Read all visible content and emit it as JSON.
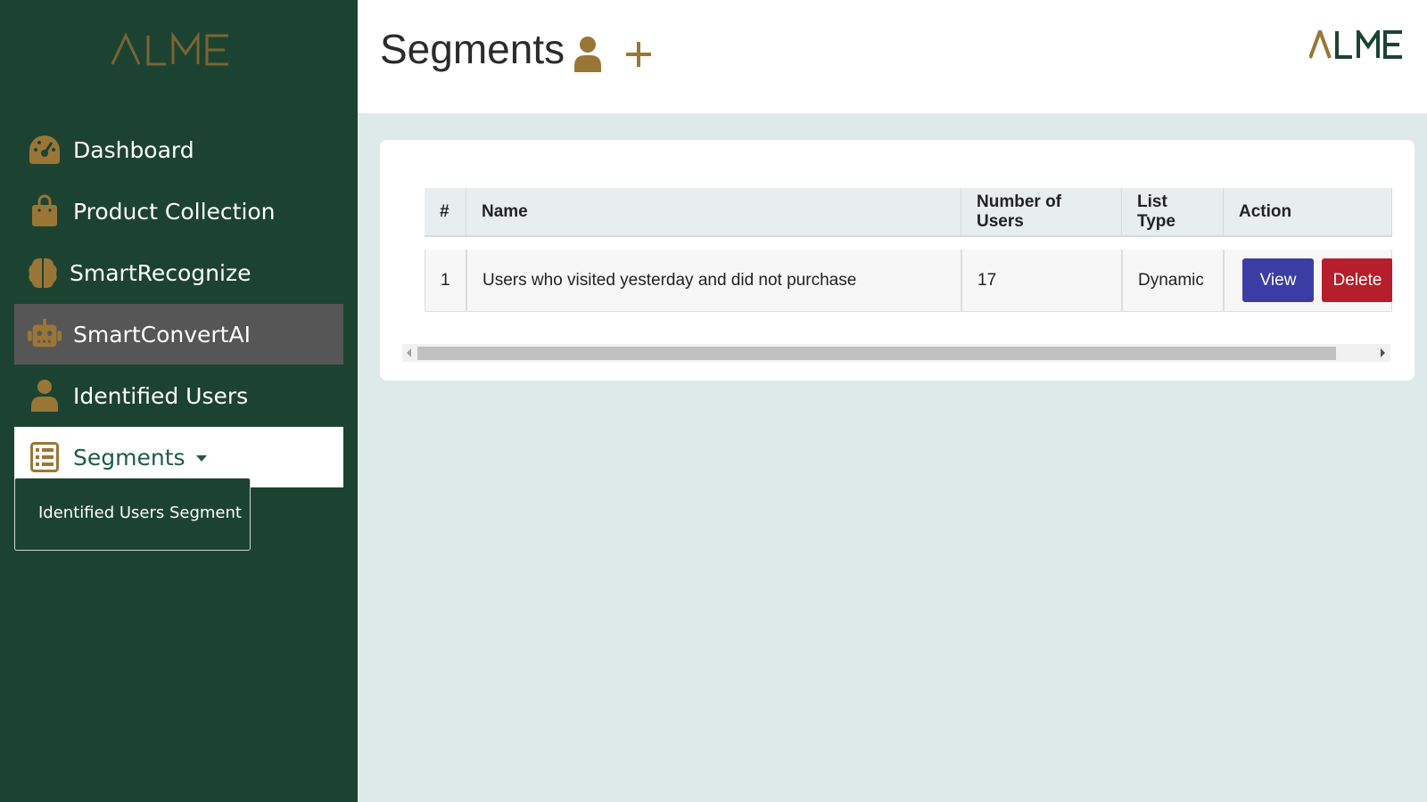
{
  "brand": {
    "logo_text": "ALME"
  },
  "colors": {
    "sidebar_bg": "#1c4331",
    "accent_gold": "#9a7636",
    "active_item_bg": "#565656",
    "view_button": "#3b3da5",
    "delete_button": "#b51e2a",
    "content_bg": "#deeaea"
  },
  "sidebar": {
    "items": [
      {
        "label": "Dashboard",
        "icon": "speedometer-icon"
      },
      {
        "label": "Product Collection",
        "icon": "shopping-bag-icon"
      },
      {
        "label": "SmartRecognize",
        "icon": "brain-icon"
      },
      {
        "label": "SmartConvertAI",
        "icon": "robot-icon",
        "active": true
      },
      {
        "label": "Identified Users",
        "icon": "user-icon"
      },
      {
        "label": "Segments",
        "icon": "list-icon",
        "expanded": true
      }
    ],
    "dropdown": {
      "items": [
        {
          "label": "Identified Users Segment"
        }
      ]
    }
  },
  "header": {
    "title": "Segments",
    "icons": [
      "user-icon",
      "plus-icon"
    ]
  },
  "table": {
    "columns": [
      "#",
      "Name",
      "Number of Users",
      "List Type",
      "Action"
    ],
    "rows": [
      {
        "index": "1",
        "name": "Users who visited yesterday and did not purchase",
        "users": "17",
        "list_type": "Dynamic",
        "actions": {
          "view": "View",
          "delete": "Delete"
        }
      }
    ]
  }
}
